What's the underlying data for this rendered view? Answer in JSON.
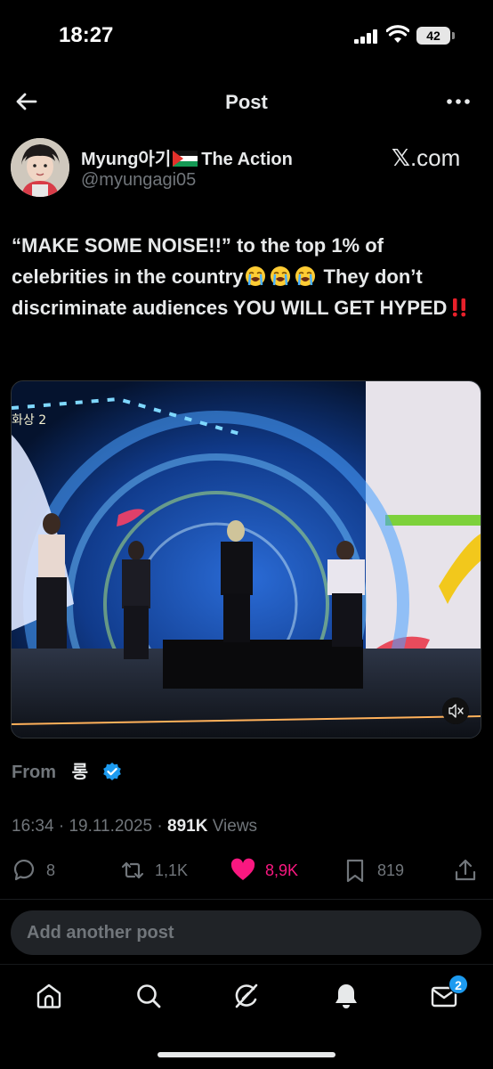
{
  "status_bar": {
    "time": "18:27",
    "battery_level": "42",
    "icons": [
      "signal-icon",
      "wifi-icon",
      "battery-icon"
    ]
  },
  "header": {
    "title": "Post",
    "back_icon": "back-arrow-icon",
    "more_icon": "more-dots-icon"
  },
  "author": {
    "name_prefix": "Myung아기",
    "name_suffix": "The Action",
    "flag_icon": "palestine-flag-icon",
    "handle": "@myungagi05",
    "source": ".com",
    "source_logo": "𝕏"
  },
  "post": {
    "text_line1": "“MAKE SOME NOISE!!” to the top 1% of celebrities in the country",
    "text_line2": "They don’t discriminate audiences YOU WILL GET HYPED",
    "emoji_icon": "loudly-crying-face-icon",
    "emoji_count": 3,
    "exclamation_icon": "double-exclamation-icon"
  },
  "media": {
    "type": "video",
    "overlay_text": "화상 2",
    "sound_icon": "muted-speaker-icon"
  },
  "attribution": {
    "from_label": "From",
    "from_name": "롱",
    "verified_icon": "verified-badge-icon"
  },
  "meta": {
    "time": "16:34",
    "date": "19.11.2025",
    "views_count": "891K",
    "views_label": "Views",
    "separator": "·"
  },
  "actions": {
    "replies": "8",
    "reposts": "1,1K",
    "likes": "8,9K",
    "bookmarks": "819",
    "liked": true
  },
  "reply_box": {
    "placeholder": "Add another post"
  },
  "bottom_nav": {
    "items": [
      "home-icon",
      "search-icon",
      "grok-icon",
      "notifications-icon",
      "messages-icon"
    ],
    "messages_badge": "2"
  },
  "colors": {
    "background": "#000000",
    "text": "#e7e9ea",
    "secondary": "#71767b",
    "like": "#f91880",
    "accent": "#1d9bf0"
  }
}
